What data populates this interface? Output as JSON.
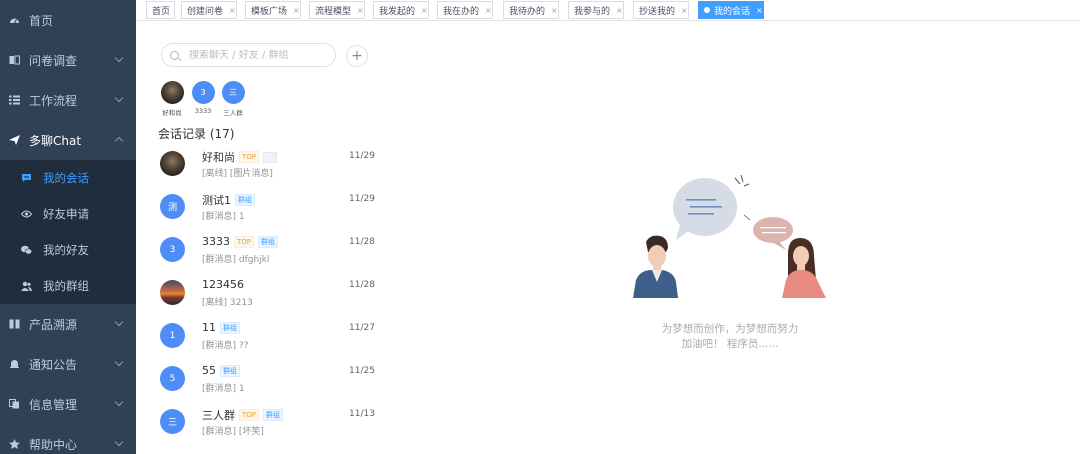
{
  "sidebar": {
    "items": [
      {
        "label": "首页",
        "icon": "dashboard-icon"
      },
      {
        "label": "问卷调查",
        "icon": "survey-icon"
      },
      {
        "label": "工作流程",
        "icon": "list-icon"
      },
      {
        "label": "多聊Chat",
        "icon": "send-icon"
      },
      {
        "label": "产品溯源",
        "icon": "book-icon"
      },
      {
        "label": "通知公告",
        "icon": "bell-icon"
      },
      {
        "label": "信息管理",
        "icon": "copy-icon"
      },
      {
        "label": "帮助中心",
        "icon": "star-icon"
      }
    ],
    "chat_submenu": [
      {
        "label": "我的会话",
        "icon": "chat-icon"
      },
      {
        "label": "好友申请",
        "icon": "eye-icon"
      },
      {
        "label": "我的好友",
        "icon": "wechat-icon"
      },
      {
        "label": "我的群组",
        "icon": "people-icon"
      }
    ]
  },
  "tabs": [
    {
      "label": "首页"
    },
    {
      "label": "创建问卷"
    },
    {
      "label": "模板广场"
    },
    {
      "label": "流程模型"
    },
    {
      "label": "我发起的"
    },
    {
      "label": "我在办的"
    },
    {
      "label": "我待办的"
    },
    {
      "label": "我参与的"
    },
    {
      "label": "抄送我的"
    },
    {
      "label": "我的会话"
    }
  ],
  "search": {
    "placeholder": "搜索聊天 / 好友 / 群组"
  },
  "plus_label": "+",
  "quick_contacts": [
    {
      "name": "好和尚",
      "initial": ""
    },
    {
      "name": "3333",
      "initial": "3"
    },
    {
      "name": "三人群",
      "initial": "三"
    }
  ],
  "records_title": "会话记录 (17)",
  "conversations": [
    {
      "name": "好和尚",
      "initial": "",
      "top": "TOP",
      "group": "",
      "msg": "[离线] [图片消息]",
      "time": "11/29"
    },
    {
      "name": "测试1",
      "initial": "测",
      "top": "",
      "group": "群组",
      "msg": "[群消息] 1",
      "time": "11/29"
    },
    {
      "name": "3333",
      "initial": "3",
      "top": "TOP",
      "group": "群组",
      "msg": "[群消息] dfghjkl",
      "time": "11/28"
    },
    {
      "name": "123456",
      "initial": "",
      "top": "",
      "group": "",
      "msg": "[离线] 3213",
      "time": "11/28"
    },
    {
      "name": "11",
      "initial": "1",
      "top": "",
      "group": "群组",
      "msg": "[群消息] ??",
      "time": "11/27"
    },
    {
      "name": "55",
      "initial": "5",
      "top": "",
      "group": "群组",
      "msg": "[群消息] 1",
      "time": "11/25"
    },
    {
      "name": "三人群",
      "initial": "三",
      "top": "TOP",
      "group": "群组",
      "msg": "[群消息] [坏笑]",
      "time": "11/13"
    }
  ],
  "empty_state": {
    "line1": "为梦想而创作，为梦想而努力",
    "line2": "加油吧！ 程序员......"
  },
  "colors": {
    "sidebar_bg": "#304156",
    "submenu_bg": "#1f2d3d",
    "accent": "#409eff",
    "avatar_blue": "#4e8df5"
  }
}
